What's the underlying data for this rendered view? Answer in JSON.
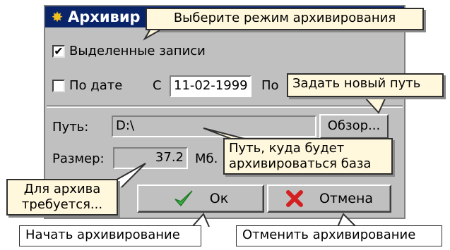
{
  "window": {
    "title": "Архивир"
  },
  "options": {
    "selected_records_label": "Выделенные записи",
    "selected_records_checked": true,
    "by_date_label": "По дате",
    "by_date_checked": false,
    "from_label": "С",
    "from_value": "11-02-1999",
    "to_label": "По"
  },
  "path": {
    "label": "Путь:",
    "value": "D:\\",
    "browse_label": "Обзор..."
  },
  "size": {
    "label": "Размер:",
    "value": "37.2",
    "unit": "Мб."
  },
  "buttons": {
    "ok_label": "Ок",
    "cancel_label": "Отмена"
  },
  "tooltips": {
    "mode": "Выберите режим архивирования",
    "new_path": "Задать новый путь",
    "db_path_line1": "Путь, куда будет",
    "db_path_line2": "архивироваться база",
    "required_line1": "Для архива",
    "required_line2": "требуется...",
    "start": "Начать архивирование",
    "cancel": "Отменить архивирование"
  },
  "icons": {
    "title_icon": "archive-icon",
    "ok_icon": "check-icon",
    "cancel_icon": "cross-icon"
  },
  "colors": {
    "titlebar": "#0a246a",
    "dialog": "#c0c0c0",
    "tooltip": "#fff8dc",
    "ok_check": "#3cb043",
    "cancel_cross": "#d42020"
  }
}
